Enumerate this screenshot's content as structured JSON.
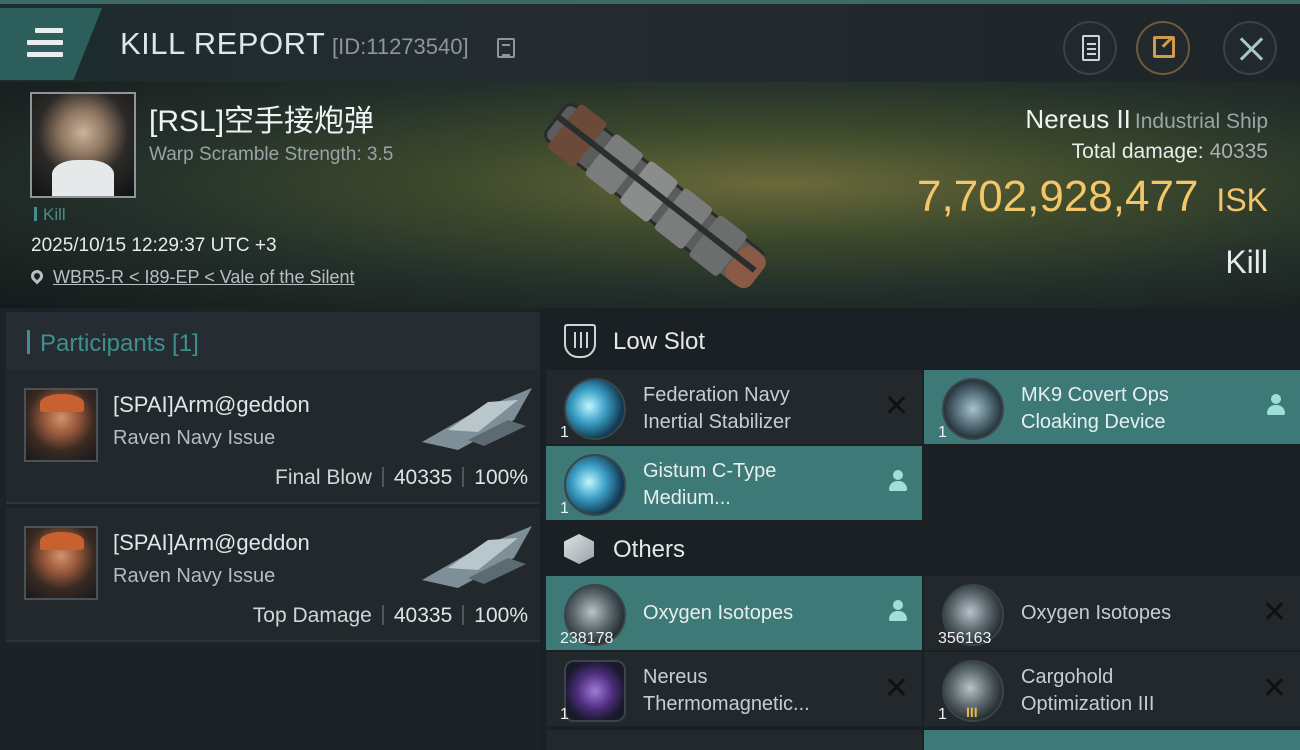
{
  "header": {
    "title": "KILL REPORT",
    "report_id": "[ID:11273540]",
    "icons": [
      "menu-icon",
      "copy-icon",
      "clipboard-icon",
      "share-icon",
      "close-icon"
    ]
  },
  "victim": {
    "name": "[RSL]空手接炮弹",
    "warp_scramble": "Warp Scramble Strength: 3.5",
    "kill_tag": "Kill",
    "datetime": "2025/10/15 12:29:37 UTC +3",
    "location": "WBR5-R < I89-EP < Vale of the Silent",
    "ship_name": "Nereus II",
    "ship_class": "Industrial Ship",
    "total_damage_label": "Total damage:",
    "total_damage": "40335",
    "isk_value": "7,702,928,477",
    "isk_unit": "ISK",
    "result_label": "Kill"
  },
  "participants": {
    "title": "Participants [1]",
    "list": [
      {
        "name": "[SPAI]Arm@geddon",
        "ship": "Raven Navy Issue",
        "role": "Final Blow",
        "damage": "40335",
        "percent": "100%"
      },
      {
        "name": "[SPAI]Arm@geddon",
        "ship": "Raven Navy Issue",
        "role": "Top Damage",
        "damage": "40335",
        "percent": "100%"
      }
    ]
  },
  "slots": {
    "low_slot": {
      "title": "Low Slot",
      "items": [
        {
          "line1": "Federation Navy",
          "line2": "Inertial Stabilizer",
          "qty": "1",
          "status": "destroyed"
        },
        {
          "line1": "MK9 Covert Ops",
          "line2": "Cloaking Device",
          "qty": "1",
          "status": "dropped"
        },
        {
          "line1": "Gistum C-Type",
          "line2": "Medium...",
          "qty": "1",
          "status": "dropped"
        }
      ]
    },
    "others": {
      "title": "Others",
      "items": [
        {
          "line1": "Oxygen Isotopes",
          "qty": "238178",
          "status": "dropped"
        },
        {
          "line1": "Oxygen Isotopes",
          "qty": "356163",
          "status": "destroyed"
        },
        {
          "line1": "Nereus",
          "line2": "Thermomagnetic...",
          "qty": "1",
          "status": "destroyed"
        },
        {
          "line1": "Cargohold",
          "line2": "Optimization III",
          "qty": "1",
          "status": "destroyed"
        }
      ]
    }
  },
  "colors": {
    "accent_teal": "#3f8f8c",
    "isk_gold": "#f4c66a",
    "highlight_row": "#3d7a77"
  }
}
